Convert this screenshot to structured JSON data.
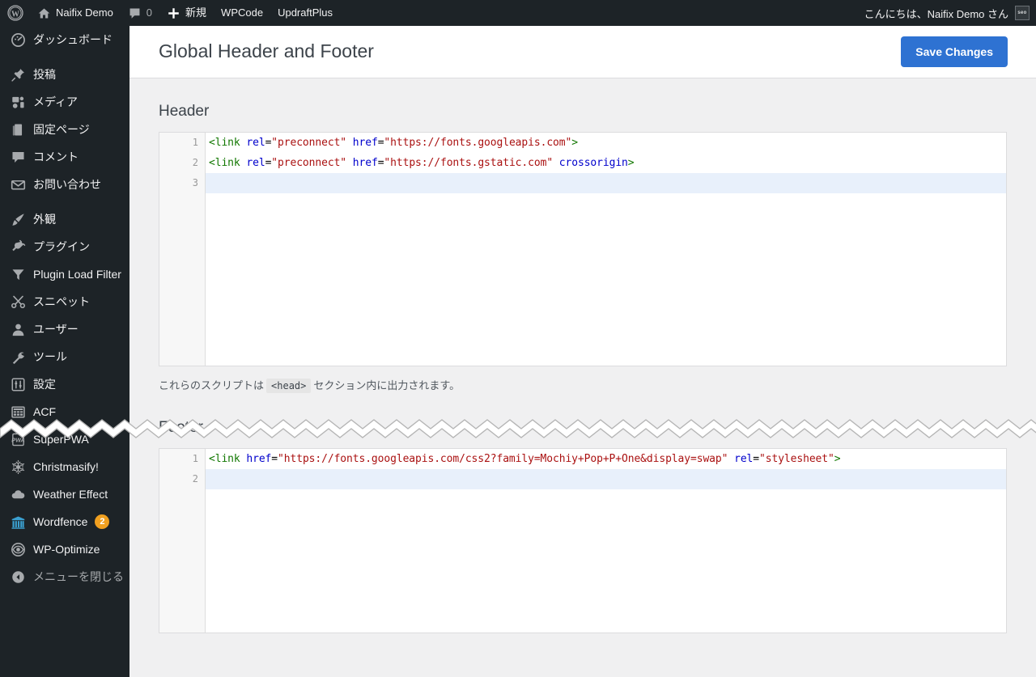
{
  "adminbar": {
    "wp_logo": "wordpress-logo",
    "site_name": "Naifix Demo",
    "comment_count": "0",
    "new_label": "新規",
    "wpcode_label": "WPCode",
    "updraft_label": "UpdraftPlus",
    "howdy": "こんにちは、Naifix Demo さん",
    "avatar_text": "seo"
  },
  "sidebar": {
    "items": [
      {
        "label": "ダッシュボード",
        "icon": "dashboard-icon"
      },
      {
        "separator": true
      },
      {
        "label": "投稿",
        "icon": "pin-icon"
      },
      {
        "label": "メディア",
        "icon": "media-icon"
      },
      {
        "label": "固定ページ",
        "icon": "page-icon"
      },
      {
        "label": "コメント",
        "icon": "comment-icon"
      },
      {
        "label": "お問い合わせ",
        "icon": "mail-icon"
      },
      {
        "separator": true
      },
      {
        "label": "外観",
        "icon": "appearance-brush-icon"
      },
      {
        "label": "プラグイン",
        "icon": "plugin-plug-icon"
      },
      {
        "label": "Plugin Load Filter",
        "icon": "funnel-filter-icon"
      },
      {
        "label": "スニペット",
        "icon": "scissors-icon"
      },
      {
        "label": "ユーザー",
        "icon": "user-icon"
      },
      {
        "label": "ツール",
        "icon": "wrench-icon"
      },
      {
        "label": "設定",
        "icon": "sliders-settings-icon"
      },
      {
        "label": "ACF",
        "icon": "acf-grid-icon"
      },
      {
        "label": "SuperPWA",
        "icon": "superpwa-icon"
      },
      {
        "label": "Christmasify!",
        "icon": "snowflake-icon"
      },
      {
        "label": "Weather Effect",
        "icon": "cloud-icon"
      },
      {
        "label": "Wordfence",
        "icon": "wordfence-icon",
        "badge": "2"
      },
      {
        "label": "WP-Optimize",
        "icon": "eye-icon"
      },
      {
        "label": "メニューを閉じる",
        "icon": "collapse-arrow-icon",
        "collapse": true
      }
    ]
  },
  "page": {
    "title": "Global Header and Footer",
    "save_label": "Save Changes"
  },
  "header_section": {
    "title": "Header",
    "lines": [
      {
        "number": "1",
        "active": false,
        "tokens": [
          {
            "t": "tag",
            "v": "<link"
          },
          {
            "t": "plain",
            "v": " "
          },
          {
            "t": "attr",
            "v": "rel"
          },
          {
            "t": "plain",
            "v": "="
          },
          {
            "t": "str",
            "v": "\"preconnect\""
          },
          {
            "t": "plain",
            "v": " "
          },
          {
            "t": "attr",
            "v": "href"
          },
          {
            "t": "plain",
            "v": "="
          },
          {
            "t": "str",
            "v": "\"https://fonts.googleapis.com\""
          },
          {
            "t": "tag",
            "v": ">"
          }
        ]
      },
      {
        "number": "2",
        "active": false,
        "tokens": [
          {
            "t": "tag",
            "v": "<link"
          },
          {
            "t": "plain",
            "v": " "
          },
          {
            "t": "attr",
            "v": "rel"
          },
          {
            "t": "plain",
            "v": "="
          },
          {
            "t": "str",
            "v": "\"preconnect\""
          },
          {
            "t": "plain",
            "v": " "
          },
          {
            "t": "attr",
            "v": "href"
          },
          {
            "t": "plain",
            "v": "="
          },
          {
            "t": "str",
            "v": "\"https://fonts.gstatic.com\""
          },
          {
            "t": "plain",
            "v": " "
          },
          {
            "t": "attr",
            "v": "crossorigin"
          },
          {
            "t": "tag",
            "v": ">"
          }
        ]
      },
      {
        "number": "3",
        "active": true,
        "tokens": []
      }
    ],
    "hint_before": "これらのスクリプトは",
    "hint_code": "<head>",
    "hint_after": "セクション内に出力されます。"
  },
  "footer_section": {
    "title": "Footer",
    "lines": [
      {
        "number": "1",
        "active": false,
        "tokens": [
          {
            "t": "tag",
            "v": "<link"
          },
          {
            "t": "plain",
            "v": " "
          },
          {
            "t": "attr",
            "v": "href"
          },
          {
            "t": "plain",
            "v": "="
          },
          {
            "t": "str",
            "v": "\"https://fonts.googleapis.com/css2?family=Mochiy+Pop+P+One&display=swap\""
          },
          {
            "t": "plain",
            "v": " "
          },
          {
            "t": "attr",
            "v": "rel"
          },
          {
            "t": "plain",
            "v": "="
          },
          {
            "t": "str",
            "v": "\"stylesheet\""
          },
          {
            "t": "tag",
            "v": ">"
          }
        ]
      },
      {
        "number": "2",
        "active": true,
        "tokens": []
      }
    ]
  },
  "colors": {
    "admin_bar": "#1d2327",
    "sidebar": "#1d2327",
    "page_bg": "#f0f0f1",
    "accent_button": "#2e72d2",
    "badge": "#f0a020",
    "active_line": "#e8f0fb",
    "code_tag": "#117700",
    "code_attr": "#0000cc",
    "code_string": "#aa1111"
  }
}
